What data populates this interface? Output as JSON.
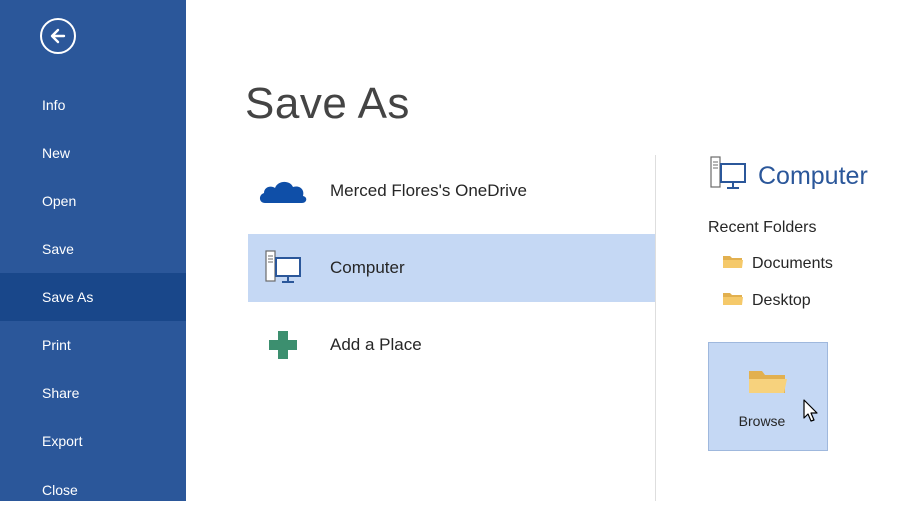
{
  "sidebar": {
    "items": [
      {
        "label": "Info"
      },
      {
        "label": "New"
      },
      {
        "label": "Open"
      },
      {
        "label": "Save"
      },
      {
        "label": "Save As",
        "active": true
      },
      {
        "label": "Print"
      },
      {
        "label": "Share"
      },
      {
        "label": "Export"
      },
      {
        "label": "Close"
      }
    ],
    "back_icon": "back-arrow-circle-icon"
  },
  "main": {
    "title": "Save As",
    "places": [
      {
        "label": "Merced Flores's OneDrive",
        "icon": "onedrive-cloud-icon"
      },
      {
        "label": "Computer",
        "icon": "computer-icon",
        "selected": true
      },
      {
        "label": "Add a Place",
        "icon": "plus-icon"
      }
    ]
  },
  "right_pane": {
    "title": "Computer",
    "recent_label": "Recent Folders",
    "folders": [
      {
        "label": "Documents",
        "icon": "folder-icon"
      },
      {
        "label": "Desktop",
        "icon": "folder-icon"
      }
    ],
    "browse_label": "Browse"
  },
  "colors": {
    "sidebar": "#2b579a",
    "sidebar_active": "#19478a",
    "selection": "#c5d8f4",
    "accent_text": "#2b579a",
    "plus_green": "#3c8f6f",
    "folder_yellow": "#f5c96a"
  }
}
